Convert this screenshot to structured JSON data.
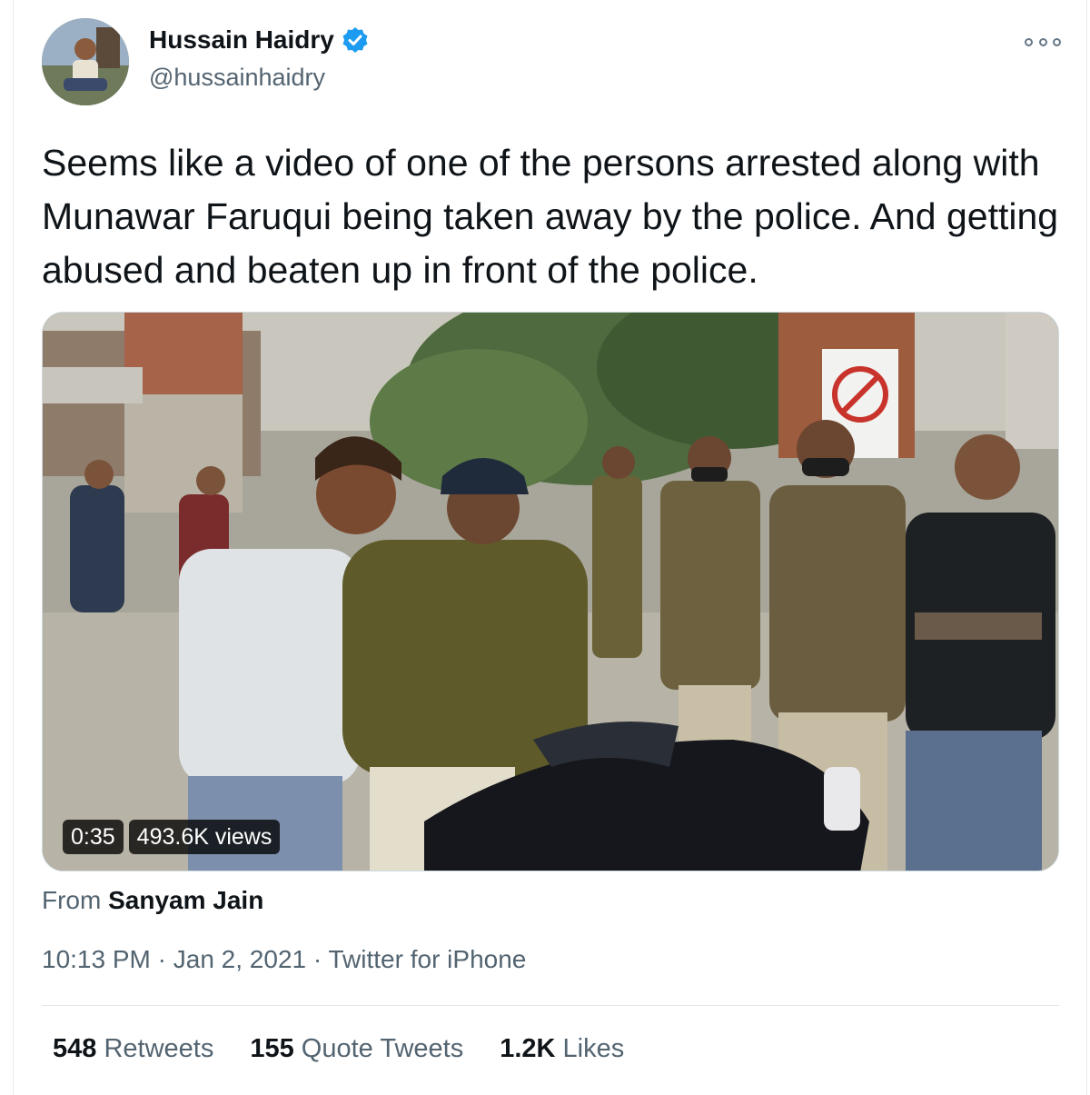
{
  "author": {
    "display_name": "Hussain Haidry",
    "handle": "@hussainhaidry",
    "verified": true
  },
  "icons": {
    "verified": "verified-badge-icon",
    "more": "more-options-icon",
    "verified_color": "#1d9bf0"
  },
  "tweet": {
    "text": "Seems like a video of one of the persons arrested along with Munawar Faruqui being taken away by the police. And getting abused and beaten up in front of the police."
  },
  "media": {
    "duration": "0:35",
    "views": "493.6K views"
  },
  "source": {
    "prefix": "From",
    "name": "Sanyam Jain"
  },
  "meta": {
    "time": "10:13 PM",
    "sep1": "·",
    "date": "Jan 2, 2021",
    "sep2": "·",
    "app": "Twitter for iPhone"
  },
  "stats": {
    "retweets_count": "548",
    "retweets_label": "Retweets",
    "quotes_count": "155",
    "quotes_label": "Quote Tweets",
    "likes_count": "1.2K",
    "likes_label": "Likes"
  }
}
